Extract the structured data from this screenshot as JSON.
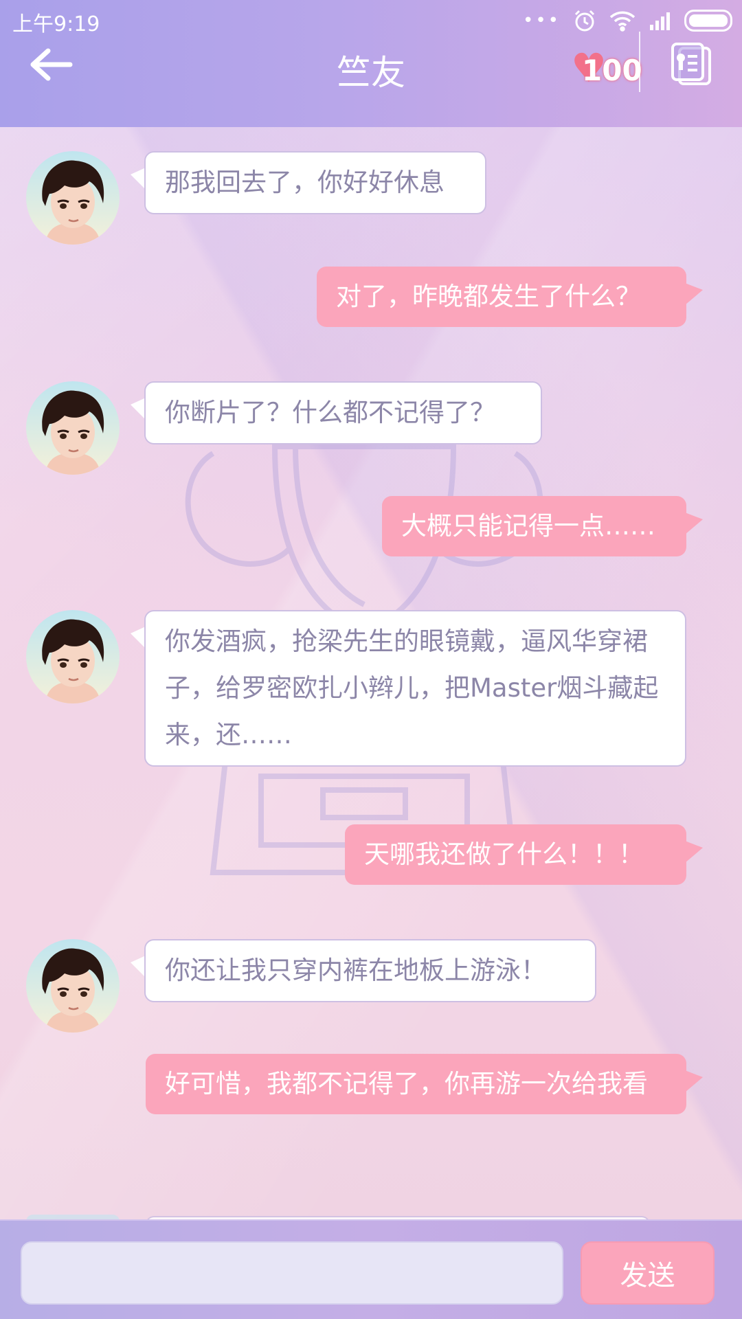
{
  "status_bar": {
    "time": "上午9:19",
    "dots": "•••"
  },
  "header": {
    "title": "竺友",
    "heart_count": "100"
  },
  "messages": [
    {
      "side": "left",
      "text": "那我回去了，你好好休息"
    },
    {
      "side": "right",
      "text": "对了，昨晚都发生了什么？"
    },
    {
      "side": "left",
      "text": "你断片了？什么都不记得了？"
    },
    {
      "side": "right",
      "text": "大概只能记得一点……"
    },
    {
      "side": "left",
      "text": "你发酒疯，抢梁先生的眼镜戴，逼风华穿裙子，给罗密欧扎小辫儿，把Master烟斗藏起来，还……"
    },
    {
      "side": "right",
      "text": "天哪我还做了什么！！！"
    },
    {
      "side": "left",
      "text": "你还让我只穿内裤在地板上游泳！"
    },
    {
      "side": "right",
      "text": "好可惜，我都不记得了，你再游一次给我看"
    }
  ],
  "input": {
    "value": "",
    "send_label": "发送"
  },
  "colors": {
    "header_start": "#a9a0ea",
    "header_end": "#d4ace3",
    "outgoing_bubble": "#fba5bb",
    "incoming_text": "#8c86a8",
    "heart": "#f2718a"
  }
}
